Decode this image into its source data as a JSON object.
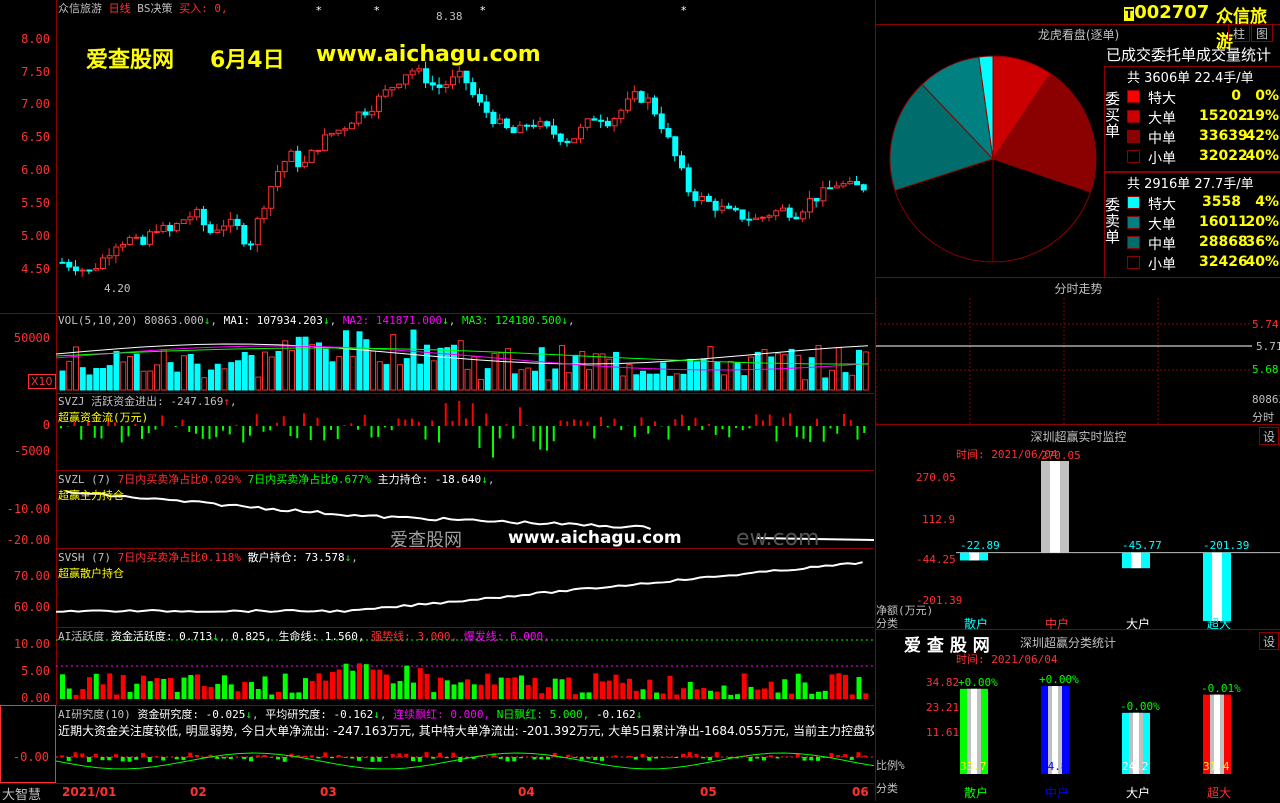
{
  "stock": {
    "code": "002707",
    "name": "众信旅游",
    "chart_mode": "日线",
    "strategy": "BS决策",
    "buy_label": "买入: 0,"
  },
  "watermark": {
    "site": "爱查股网",
    "date": "6月4日",
    "url": "www.aichagu.com",
    "center_site": "爱查股网",
    "center_url": "www.aichagu.com",
    "ghost_text": "ew.com"
  },
  "price_axis": [
    "8.00",
    "7.50",
    "7.00",
    "6.50",
    "6.00",
    "5.50",
    "5.00",
    "4.50"
  ],
  "price_marks": {
    "high": "8.38",
    "low": "4.20"
  },
  "vol": {
    "header_label": "VOL(5,10,20)",
    "vol": "80863.000",
    "ma1": "MA1: 107934.203",
    "ma2": "MA2: 141871.000",
    "ma3": "MA3: 124180.500",
    "axis": [
      "50000"
    ],
    "unit": "X10"
  },
  "svzj": {
    "header": "SVZJ  活跃资金进出: -247.169",
    "subtitle": "超赢资金流(万元)",
    "axis": [
      "0",
      "-5000"
    ]
  },
  "svzl": {
    "header": "SVZL (7)",
    "p1": "7日内买卖净占比0.029%",
    "p2": "7日内买卖净占比0.677%",
    "p3": "主力持仓: -18.640",
    "subtitle": "超赢主力持仓",
    "axis": [
      "-10.00",
      "-20.00"
    ]
  },
  "svsh": {
    "header": "SVSH (7)",
    "p1": "7日内买卖净占比0.118%",
    "p2": "散户持仓: 73.578",
    "subtitle": "超赢散户持仓",
    "axis": [
      "70.00",
      "60.00"
    ]
  },
  "ai": {
    "header": "AI活跃度",
    "p1": "资金活跃度: 0.713",
    "p2": "0.825,",
    "p3": "生命线: 1.560,",
    "p4": "强势线: 3.000,",
    "p5": "爆发线: 6.000,",
    "axis": [
      "10.00",
      "5.00",
      "0.00"
    ]
  },
  "research": {
    "header": "AI研究度(10)",
    "p1": "资金研究度: -0.025",
    "p2": "平均研究度: -0.162",
    "p3": "连续飘红: 0.000,",
    "p4": "N日飘红: 5.000,",
    "p5": "-0.162",
    "line": "近期大资金关注度较低, 明显弱势, 今日大单净流出: -247.163万元, 其中特大单净流出: -201.392万元, 大单5日累计净出-1684.055万元, 当前主力控盘较",
    "axis": [
      "-0.00"
    ]
  },
  "bottom": {
    "brand": "大智慧",
    "months": [
      "2021/01",
      "02",
      "03",
      "04",
      "05",
      "06"
    ]
  },
  "right_panel": {
    "col_button": "柱",
    "settings_button": "图",
    "dragon": {
      "title": "龙虎看盘(逐单)",
      "subtitle": "已成交委托单成交量统计",
      "buy": {
        "side_label": "委买单",
        "total": "共 3606单 22.4手/单",
        "rows": [
          {
            "name": "特大",
            "count": "0",
            "pct": "0%",
            "color": "#ff0000"
          },
          {
            "name": "大单",
            "count": "15202",
            "pct": "19%",
            "color": "#cc0000"
          },
          {
            "name": "中单",
            "count": "33639",
            "pct": "42%",
            "color": "#8b0000"
          },
          {
            "name": "小单",
            "count": "32022",
            "pct": "40%",
            "color": "#000000"
          }
        ]
      },
      "sell": {
        "side_label": "委卖单",
        "total": "共 2916单 27.7手/单",
        "rows": [
          {
            "name": "特大",
            "count": "3558",
            "pct": "4%",
            "color": "#00ffff"
          },
          {
            "name": "大单",
            "count": "16011",
            "pct": "20%",
            "color": "#008080"
          },
          {
            "name": "中单",
            "count": "28868",
            "pct": "36%",
            "color": "#006c6c"
          },
          {
            "name": "小单",
            "count": "32426",
            "pct": "40%",
            "color": "#000000"
          }
        ]
      }
    },
    "intraday": {
      "title": "分时走势",
      "axis": [
        "5.74",
        "5.71",
        "5.68"
      ],
      "vol": "80863",
      "unit": "分时"
    },
    "realtime": {
      "title": "深圳超赢实时监控",
      "time": "时间: 2021/06/04",
      "settings": "设",
      "axis": [
        "270.05",
        "112.9",
        "-44.25",
        "-201.39"
      ],
      "ylabel": "净额(万元)",
      "xlabel": "分类",
      "categories": [
        "散户",
        "中户",
        "大户",
        "超大"
      ],
      "values": [
        "-22.89",
        "270.05",
        "-45.77",
        "-201.39"
      ]
    },
    "classify": {
      "title": "深圳超赢分类统计",
      "brand": "爱 查 股 网",
      "time": "时间: 2021/06/04",
      "settings": "设",
      "axis": [
        "34.82",
        "23.21",
        "11.61"
      ],
      "ylabel": "比例%",
      "xlabel": "分类",
      "categories": [
        "散户",
        "中户",
        "大户",
        "超大"
      ],
      "changes": [
        "+0.00%",
        "+0.00%",
        "-0.00%",
        "-0.01%"
      ],
      "values": [
        "33.7",
        "34.8",
        "24.2",
        "31.4"
      ]
    }
  },
  "colors": {
    "up": "#ff3030",
    "down": "#00ffff",
    "grid": "#8b0000",
    "yellow": "#ffff00"
  }
}
